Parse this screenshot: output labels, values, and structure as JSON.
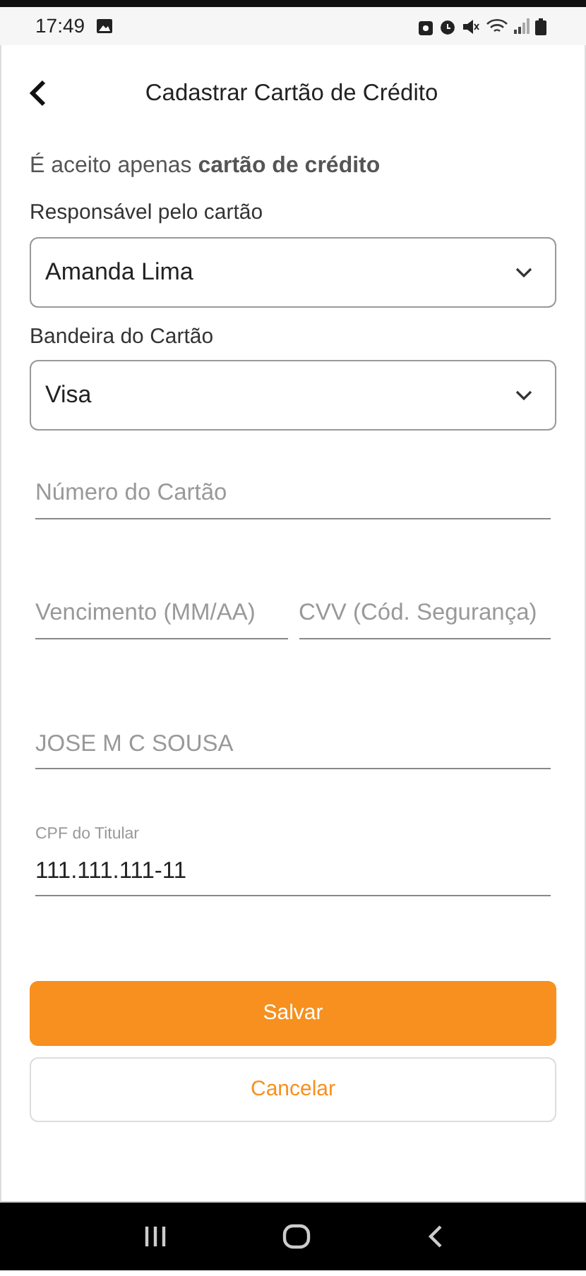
{
  "status_bar": {
    "time": "17:49"
  },
  "header": {
    "title": "Cadastrar Cartão de Crédito"
  },
  "notice": "É aceito apenas **cartão de crédito**",
  "selects": [
    {
      "label": "Responsável pelo cartão",
      "value": "Amanda Lima"
    },
    {
      "label": "Bandeira do Cartão",
      "value": "Visa"
    }
  ],
  "fields": [
    {
      "placeholder": "Número do Cartão"
    },
    {
      "placeholder": "Vencimento (MM/AA)"
    },
    {
      "placeholder": "CVV (Cód. Segurança)"
    },
    {
      "placeholder": "JOSE M C SOUSA"
    },
    {
      "label": "CPF do Titular",
      "value": "111.111.111-11"
    }
  ],
  "buttons": [
    {
      "label": "Salvar",
      "kind": "primary"
    },
    {
      "label": "Cancelar",
      "kind": "outline"
    }
  ]
}
